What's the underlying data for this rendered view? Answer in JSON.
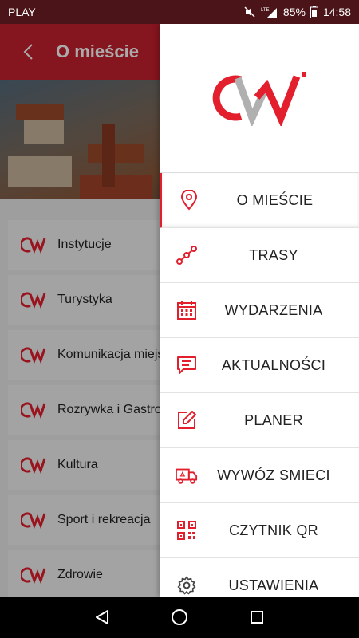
{
  "status": {
    "carrier": "PLAY",
    "battery": "85%",
    "time": "14:58",
    "network": "LTE"
  },
  "appbar": {
    "title": "O mieście"
  },
  "categories": [
    {
      "label": "Instytucje"
    },
    {
      "label": "Turystyka"
    },
    {
      "label": "Komunikacja miejska"
    },
    {
      "label": "Rozrywka i Gastronomia"
    },
    {
      "label": "Kultura"
    },
    {
      "label": "Sport i rekreacja"
    },
    {
      "label": "Zdrowie"
    }
  ],
  "drawer": {
    "items": [
      {
        "label": "O MIEŚCIE",
        "icon": "location-pin-icon"
      },
      {
        "label": "TRASY",
        "icon": "route-icon"
      },
      {
        "label": "WYDARZENIA",
        "icon": "calendar-icon"
      },
      {
        "label": "AKTUALNOŚCI",
        "icon": "chat-icon"
      },
      {
        "label": "PLANER",
        "icon": "edit-icon"
      },
      {
        "label": "WYWÓZ SMIECI",
        "icon": "truck-icon"
      },
      {
        "label": "CZYTNIK QR",
        "icon": "qr-icon"
      },
      {
        "label": "USTAWIENIA",
        "icon": "gear-icon"
      }
    ]
  },
  "colors": {
    "accent": "#e31e2d",
    "appbar": "#c7202d",
    "statusbar": "#4a1418"
  }
}
